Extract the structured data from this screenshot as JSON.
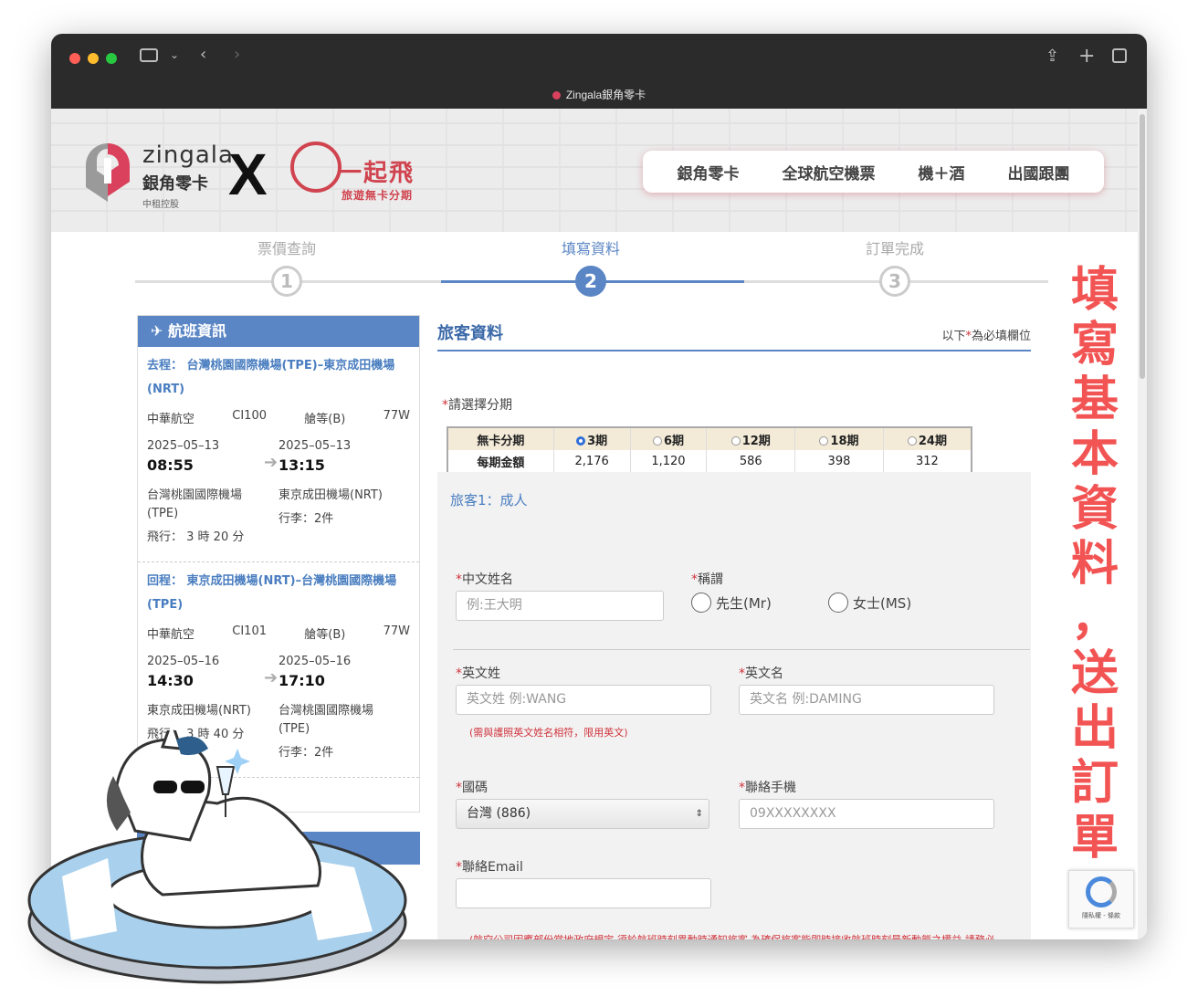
{
  "browser": {
    "tab_title": "Zingala銀角零卡"
  },
  "brand": {
    "name_en": "zingala",
    "name_zh": "銀角零卡",
    "sub": "中租控股",
    "x": "X",
    "partner_title": "一起飛",
    "partner_sub": "旅遊無卡分期"
  },
  "top_nav": [
    "銀角零卡",
    "全球航空機票",
    "機＋酒",
    "出國跟團"
  ],
  "steps": [
    {
      "label": "票價查詢",
      "num": "1"
    },
    {
      "label": "填寫資料",
      "num": "2"
    },
    {
      "label": "訂單完成",
      "num": "3"
    }
  ],
  "flight_panel": {
    "title": "航班資訊",
    "outbound": {
      "prefix": "去程：",
      "route": "台灣桃園國際機場(TPE)–東京成田機場(NRT)",
      "airline": "中華航空",
      "flight_no": "CI100",
      "cabin": "艙等(B)",
      "aircraft": "77W",
      "dep_date": "2025–05–13",
      "dep_time": "08:55",
      "arr_date": "2025–05–13",
      "arr_time": "13:15",
      "dep_airport": "台灣桃園國際機場(TPE)",
      "arr_airport": "東京成田機場(NRT)",
      "duration": "飛行： 3 時 20 分",
      "baggage": "行李：2件"
    },
    "return": {
      "prefix": "回程：",
      "route": "東京成田機場(NRT)–台灣桃園國際機場(TPE)",
      "airline": "中華航空",
      "flight_no": "CI101",
      "cabin": "艙等(B)",
      "aircraft": "77W",
      "dep_date": "2025–05–16",
      "dep_time": "14:30",
      "arr_date": "2025–05–16",
      "arr_time": "17:10",
      "dep_airport": "東京成田機場(NRT)",
      "arr_airport": "台灣桃園國際機場(TPE)",
      "duration": "飛行： 3 時 40 分",
      "baggage": "行李：2件"
    }
  },
  "form": {
    "title": "旅客資料",
    "required_note_prefix": "以下",
    "required_star": "*",
    "required_note_suffix": "為必填欄位",
    "installment_label": "請選擇分期",
    "installment_table": {
      "row_label_1": "無卡分期",
      "row_label_2": "每期金額",
      "options": [
        {
          "label": "3期",
          "amount": "2,176",
          "selected": true
        },
        {
          "label": "6期",
          "amount": "1,120",
          "selected": false
        },
        {
          "label": "12期",
          "amount": "586",
          "selected": false
        },
        {
          "label": "18期",
          "amount": "398",
          "selected": false
        },
        {
          "label": "24期",
          "amount": "312",
          "selected": false
        }
      ]
    },
    "passenger_title": "旅客1：成人",
    "chinese_name_label": "中文姓名",
    "chinese_name_placeholder": "例:王大明",
    "title_label": "稱謂",
    "title_mr": "先生(Mr)",
    "title_ms": "女士(MS)",
    "surname_label": "英文姓",
    "surname_placeholder": "英文姓 例:WANG",
    "given_label": "英文名",
    "given_placeholder": "英文名 例:DAMING",
    "name_note": "(需與護照英文姓名相符，限用英文)",
    "country_code_label": "國碼",
    "country_code_value": "台灣 (886)",
    "mobile_label": "聯絡手機",
    "mobile_placeholder": "09XXXXXXXX",
    "email_label": "聯絡Email",
    "email_value": "",
    "airline_note": "(航空公司因應部份當地政府規定,須於航班時刻異動時通知旅客,為確保旅客能即時接收航班時刻最新動態之權益,請務必提供旅客的聯絡手機號碼與Email)"
  },
  "recaptcha": {
    "text": "隱私權 - 條款"
  },
  "side_caption": [
    "填",
    "寫",
    "基",
    "本",
    "資",
    "料",
    "，",
    "送",
    "出",
    "訂",
    "單"
  ],
  "colors": {
    "accent_blue": "#5b86c5",
    "required_red": "#d0333c",
    "caption_red": "#f25454"
  }
}
